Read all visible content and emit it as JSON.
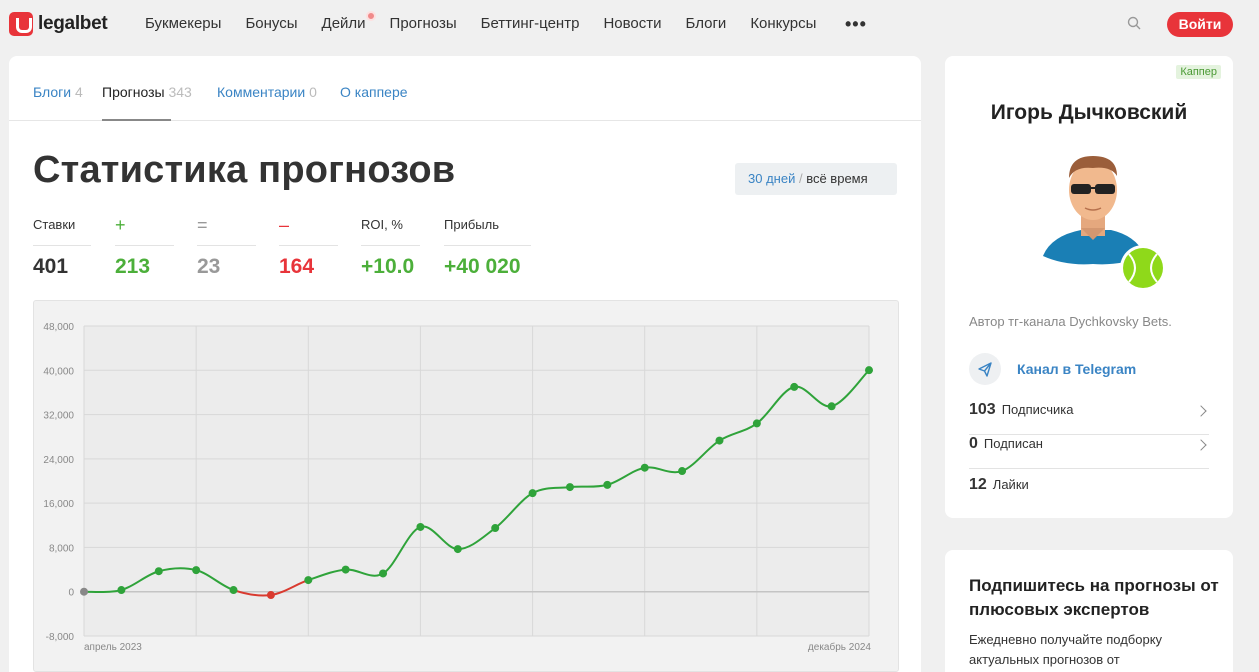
{
  "header": {
    "logo": "legalbet",
    "nav": [
      "Букмекеры",
      "Бонусы",
      "Дейли",
      "Прогнозы",
      "Беттинг-центр",
      "Новости",
      "Блоги",
      "Конкурсы"
    ],
    "more": "•••",
    "login": "Войти"
  },
  "tabs": [
    {
      "label": "Блоги",
      "count": "4"
    },
    {
      "label": "Прогнозы",
      "count": "343"
    },
    {
      "label": "Комментарии",
      "count": "0"
    },
    {
      "label": "О каппере",
      "count": ""
    }
  ],
  "page_title": "Статистика прогнозов",
  "period": {
    "days": "30 дней",
    "sep": "/",
    "all": "всё время"
  },
  "stats": [
    {
      "label": "Ставки",
      "value": "401",
      "color": "#333333"
    },
    {
      "label": "+",
      "value": "213",
      "color": "#4caf3a"
    },
    {
      "label": "=",
      "value": "23",
      "color": "#999999"
    },
    {
      "label": "–",
      "value": "164",
      "color": "#e8343a"
    },
    {
      "label": "ROI, %",
      "value": "+10.0",
      "color": "#4caf3a"
    },
    {
      "label": "Прибыль",
      "value": "+40 020",
      "color": "#4caf3a"
    }
  ],
  "chart_data": {
    "type": "line",
    "x_start_label": "апрель 2023",
    "x_end_label": "декабрь 2024",
    "yticks": [
      "48,000",
      "40,000",
      "32,000",
      "24,000",
      "16,000",
      "8,000",
      "0",
      "-8,000"
    ],
    "ylim": [
      -8000,
      48000
    ],
    "grid": true,
    "values": [
      0,
      300,
      3700,
      3900,
      300,
      -600,
      2100,
      4000,
      3300,
      11700,
      7700,
      11500,
      17800,
      18900,
      19300,
      22400,
      21800,
      27300,
      30400,
      37000,
      33500,
      40020
    ],
    "colors": {
      "positive": "#2fa33a",
      "negative": "#d93a2f",
      "start": "#888888"
    }
  },
  "profile": {
    "badge": "Каппер",
    "name": "Игорь Дычковский",
    "description": "Автор тг-канала Dychkovsky Bets.",
    "telegram": "Канал в Telegram",
    "rows": [
      {
        "num": "103",
        "label": "Подписчика"
      },
      {
        "num": "0",
        "label": "Подписан"
      },
      {
        "num": "12",
        "label": "Лайки"
      }
    ]
  },
  "subscribe": {
    "title": "Подпишитесь на прогнозы от плюсовых экспертов",
    "text": "Ежедневно получайте подборку актуальных прогнозов от"
  },
  "icons": {
    "search": "search-icon",
    "telegram": "telegram-icon",
    "tennis": "tennis-ball-icon"
  }
}
